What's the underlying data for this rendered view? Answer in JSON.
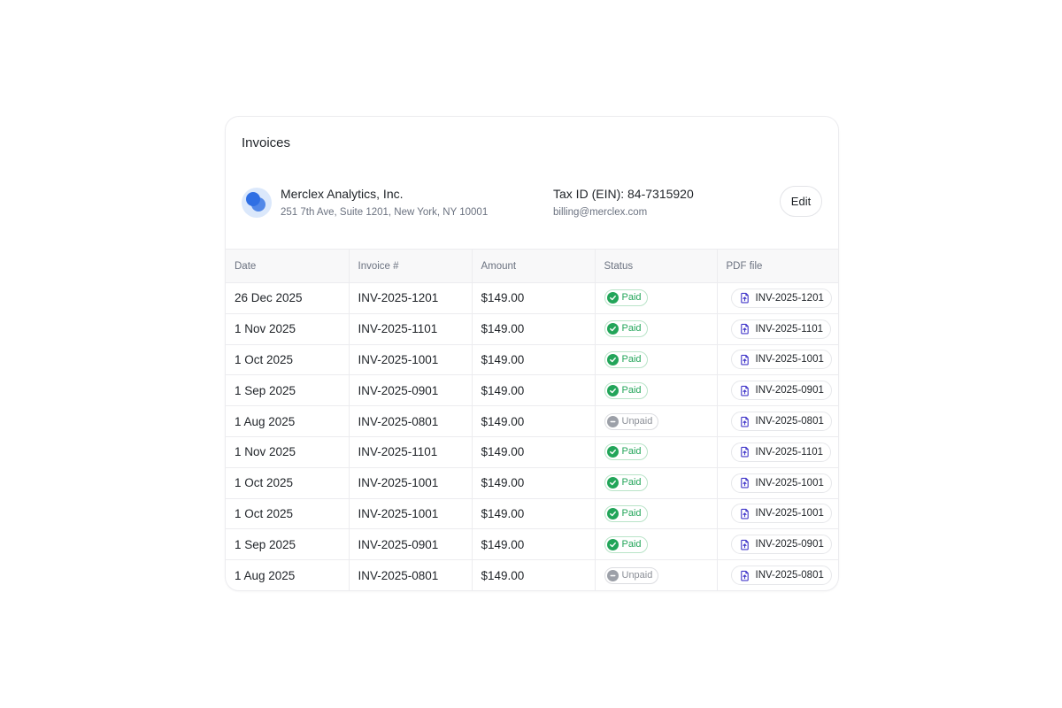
{
  "card": {
    "title": "Invoices"
  },
  "company": {
    "name": "Merclex Analytics, Inc.",
    "address": "251 7th Ave, Suite 1201, New York, NY 10001",
    "tax_id": "Tax ID (EIN): 84-7315920",
    "email": "billing@merclex.com",
    "edit_label": "Edit"
  },
  "colors": {
    "paid": "#22a559",
    "unpaid": "#9ca0a8",
    "pdf_icon": "#4338ca",
    "logo": "#2f6fe4"
  },
  "table": {
    "headers": [
      "Date",
      "Invoice #",
      "Amount",
      "Status",
      "PDF file"
    ],
    "rows": [
      {
        "date": "26 Dec 2025",
        "invoice": "INV-2025-1201",
        "amount": "$149.00",
        "status": "Paid",
        "pdf": "INV-2025-1201"
      },
      {
        "date": "1 Nov 2025",
        "invoice": "INV-2025-1101",
        "amount": "$149.00",
        "status": "Paid",
        "pdf": "INV-2025-1101"
      },
      {
        "date": "1 Oct 2025",
        "invoice": "INV-2025-1001",
        "amount": "$149.00",
        "status": "Paid",
        "pdf": "INV-2025-1001"
      },
      {
        "date": "1 Sep 2025",
        "invoice": "INV-2025-0901",
        "amount": "$149.00",
        "status": "Paid",
        "pdf": "INV-2025-0901"
      },
      {
        "date": "1 Aug 2025",
        "invoice": "INV-2025-0801",
        "amount": "$149.00",
        "status": "Unpaid",
        "pdf": "INV-2025-0801"
      },
      {
        "date": "1 Nov 2025",
        "invoice": "INV-2025-1101",
        "amount": "$149.00",
        "status": "Paid",
        "pdf": "INV-2025-1101"
      },
      {
        "date": "1 Oct 2025",
        "invoice": "INV-2025-1001",
        "amount": "$149.00",
        "status": "Paid",
        "pdf": "INV-2025-1001"
      },
      {
        "date": "1 Oct 2025",
        "invoice": "INV-2025-1001",
        "amount": "$149.00",
        "status": "Paid",
        "pdf": "INV-2025-1001"
      },
      {
        "date": "1 Sep 2025",
        "invoice": "INV-2025-0901",
        "amount": "$149.00",
        "status": "Paid",
        "pdf": "INV-2025-0901"
      },
      {
        "date": "1 Aug 2025",
        "invoice": "INV-2025-0801",
        "amount": "$149.00",
        "status": "Unpaid",
        "pdf": "INV-2025-0801"
      }
    ]
  }
}
